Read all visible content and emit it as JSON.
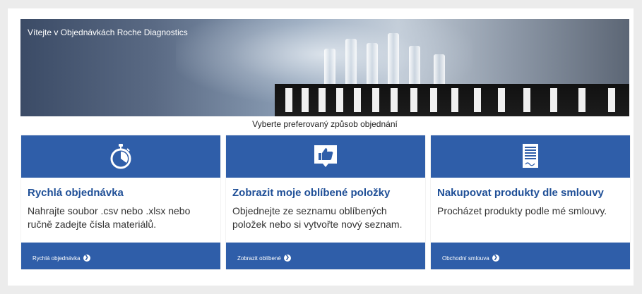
{
  "hero": {
    "title": "Vítejte v Objednávkách Roche Diagnostics"
  },
  "subtitle": "Vyberte preferovaný způsob objednání",
  "colors": {
    "accent": "#2f5ea9",
    "title": "#1f4f97",
    "background": "#ececec"
  },
  "cards": [
    {
      "icon": "stopwatch-icon",
      "title": "Rychlá objednávka",
      "desc": "Nahrajte soubor  .csv nebo  .xlsx nebo ručně zadejte čísla materiálů.",
      "link": "Rychlá objednávka"
    },
    {
      "icon": "thumbs-up-icon",
      "title": "Zobrazit moje oblíbené položky",
      "desc": "Objednejte ze seznamu oblíbených položek nebo si vytvořte nový seznam.",
      "link": "Zobrazit oblíbené"
    },
    {
      "icon": "contract-document-icon",
      "title": "Nakupovat produkty dle smlouvy",
      "desc": "Procházet produkty podle mé smlouvy.",
      "link": "Obchodní smlouva"
    }
  ]
}
